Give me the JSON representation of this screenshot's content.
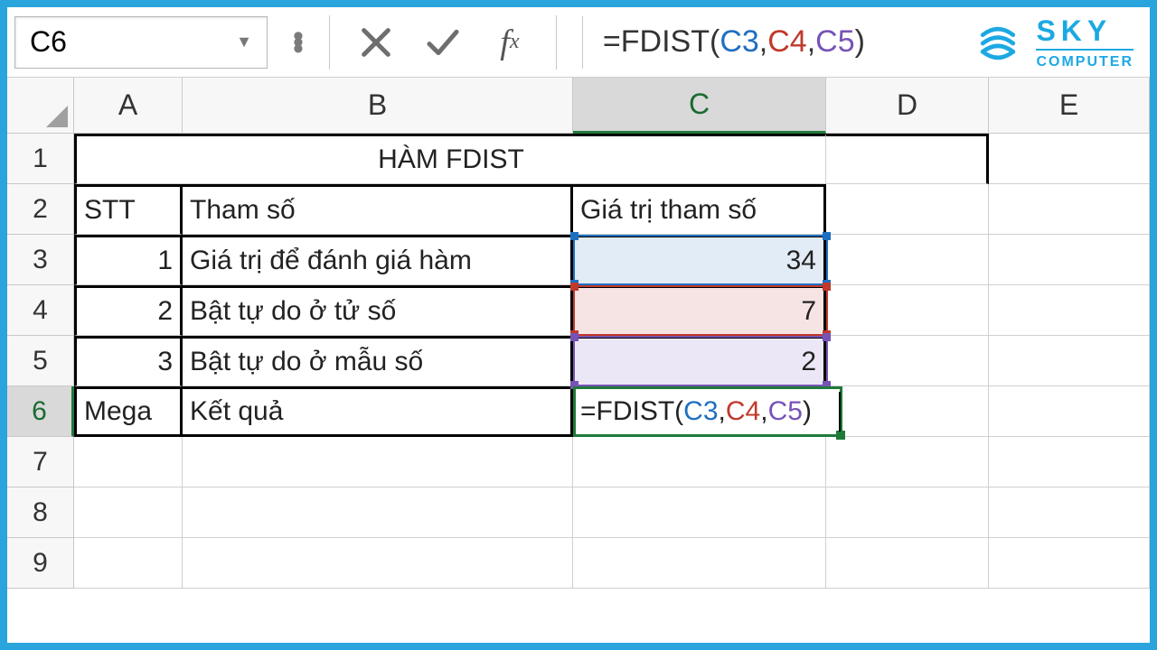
{
  "name_box": "C6",
  "formula_bar": {
    "raw": "=FDIST(C3,C4,C5)",
    "prefix": "=FDIST(",
    "ref1": "C3",
    "sep1": ",",
    "ref2": "C4",
    "sep2": ",",
    "ref3": "C5",
    "suffix": ")"
  },
  "logo": {
    "line1": "SKY",
    "line2": "COMPUTER"
  },
  "columns": [
    "A",
    "B",
    "C",
    "D",
    "E"
  ],
  "rows": [
    1,
    2,
    3,
    4,
    5,
    6,
    7,
    8,
    9
  ],
  "active_column": "C",
  "active_row": 6,
  "data": {
    "r1": {
      "title": "HÀM FDIST"
    },
    "r2": {
      "a": "STT",
      "b": "Tham số",
      "c": "Giá trị tham số"
    },
    "r3": {
      "a": "1",
      "b": "Giá trị để đánh giá hàm",
      "c": "34"
    },
    "r4": {
      "a": "2",
      "b": "Bật tự do ở tử số",
      "c": "7"
    },
    "r5": {
      "a": "3",
      "b": "Bật tự do ở mẫu số",
      "c": "2"
    },
    "r6": {
      "a": "Mega",
      "b": "Kết quả"
    }
  }
}
